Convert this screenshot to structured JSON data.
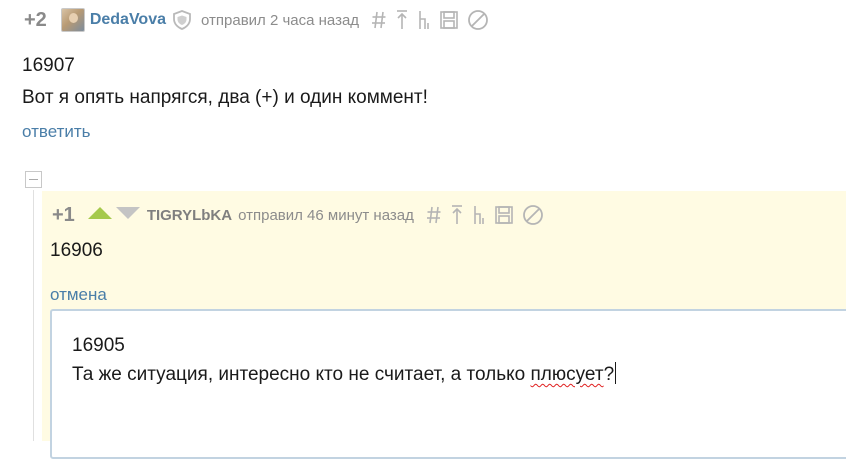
{
  "comment1": {
    "rating": "+2",
    "author": "DedaVova",
    "posted_text": "отправил 2 часа назад",
    "body_line1": "16907",
    "body_line2": "Вот я опять напрягся, два (+) и один коммент!",
    "reply_link": "ответить"
  },
  "comment2": {
    "rating": "+1",
    "author": "TIGRYLbKA",
    "posted_text": "отправил 46 минут назад",
    "body": "16906",
    "cancel_link": "отмена"
  },
  "reply_editor": {
    "line1": "16905",
    "line2_before": "Та же ситуация, интересно кто не считает, а только ",
    "line2_misspelled": "плюсует",
    "line2_after": "?"
  },
  "colors": {
    "link": "#4a7ea8",
    "meta": "#8c8c8c",
    "highlight_bg": "#fffbe3",
    "upvote": "#a5c94b",
    "downvote": "#c4c4c4"
  },
  "icons": [
    "shield-icon",
    "hash-icon",
    "arrow-up-icon",
    "tree-icon",
    "save-icon",
    "block-icon",
    "upvote-icon",
    "downvote-icon",
    "collapse-icon"
  ]
}
